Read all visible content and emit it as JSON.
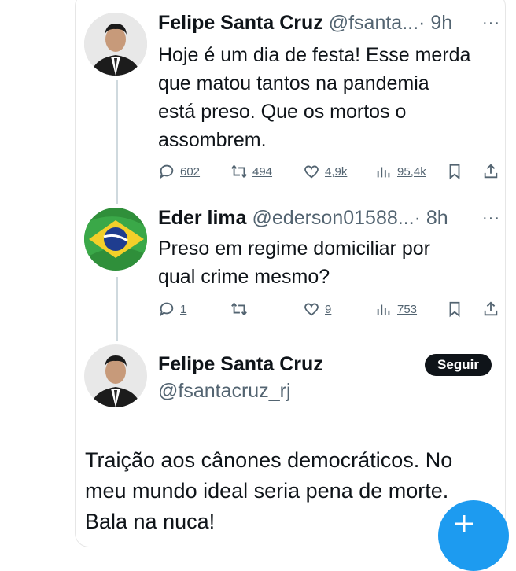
{
  "tweet1": {
    "author_name": "Felipe Santa Cruz",
    "handle": "@fsanta...",
    "time": "· 9h",
    "text_lines": [
      "Hoje é um dia de festa! Esse merda",
      "que matou tantos na pandemia",
      "está preso. Que os mortos o",
      "assombrem."
    ],
    "replies": "602",
    "retweets": "494",
    "likes": "4,9k",
    "views": "95,4k"
  },
  "tweet2": {
    "author_name": "Eder lima",
    "handle": "@ederson01588...",
    "time": "· 8h",
    "text_lines": [
      "Preso em regime domiciliar por",
      "qual crime mesmo?"
    ],
    "replies": "1",
    "retweets": "",
    "likes": "9",
    "views": "753"
  },
  "main_tweet": {
    "author_name": "Felipe Santa Cruz",
    "handle": "@fsantacruz_rj",
    "follow_label": "Seguir",
    "text_lines": [
      "Traição aos cânones democráticos. No",
      "meu mundo ideal seria pena de morte.",
      "Bala na nuca!"
    ]
  },
  "more_label": "···",
  "fab_label": "+",
  "colors": {
    "accent": "#1d9bf0",
    "text": "#0f1419",
    "muted": "#536471",
    "line": "#cfd9de"
  },
  "icons": [
    "reply-icon",
    "retweet-icon",
    "like-icon",
    "views-icon",
    "bookmark-icon",
    "share-icon",
    "plus-icon"
  ]
}
